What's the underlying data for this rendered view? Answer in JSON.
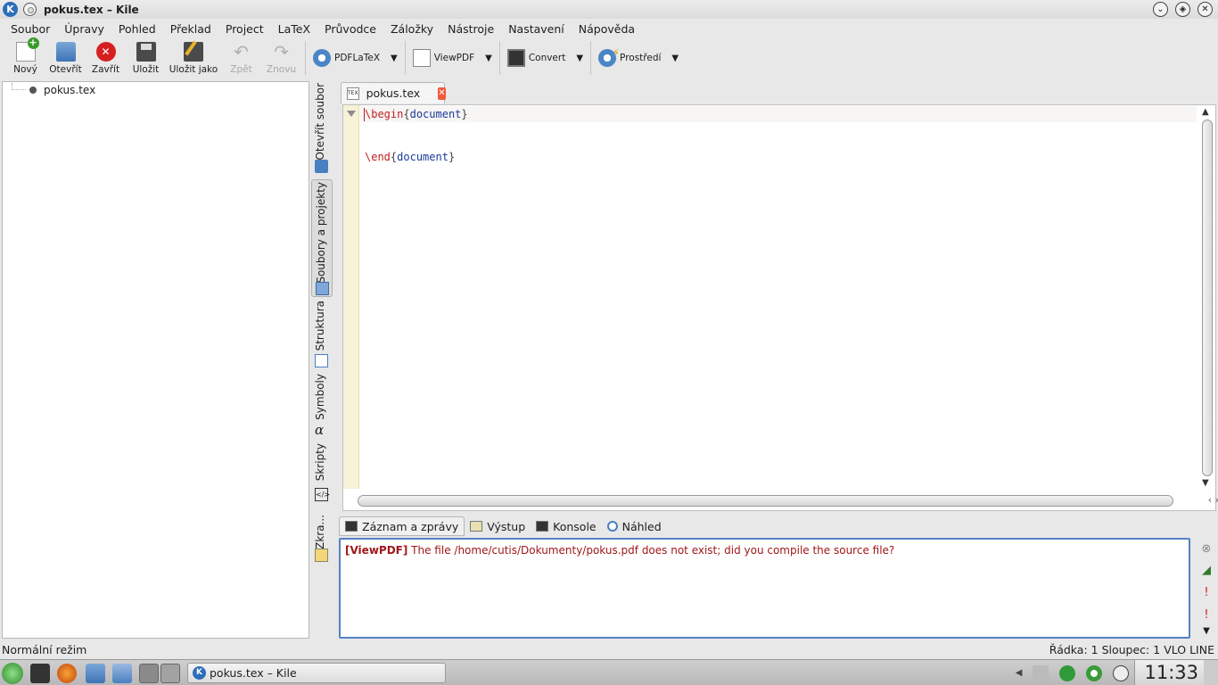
{
  "window": {
    "title": "pokus.tex – Kile"
  },
  "menubar": {
    "items": [
      "Soubor",
      "Úpravy",
      "Pohled",
      "Překlad",
      "Project",
      "LaTeX",
      "Průvodce",
      "Záložky",
      "Nástroje",
      "Nastavení",
      "Nápověda"
    ]
  },
  "toolbar": {
    "new_label": "Nový",
    "open_label": "Otevřít",
    "close_label": "Zavřít",
    "save_label": "Uložit",
    "saveas_label": "Uložit jako",
    "undo_label": "Zpět",
    "redo_label": "Znovu",
    "build_label": "PDFLaTeX",
    "view_label": "ViewPDF",
    "convert_label": "Convert",
    "env_label": "Prostředí"
  },
  "filetree": {
    "items": [
      {
        "label": "pokus.tex"
      }
    ]
  },
  "sidetabs": {
    "open_file": "Otevřít soubor",
    "files_projects": "Soubory a projekty",
    "structure": "Struktura",
    "symbols": "Symboly",
    "scripts": "Skripty",
    "abbrev": "Zkra..."
  },
  "editor": {
    "tab_label": "pokus.tex",
    "lines": [
      {
        "cmd": "\\begin",
        "open": "{",
        "arg": "document",
        "close": "}"
      },
      {
        "cmd": "\\end",
        "open": "{",
        "arg": "document",
        "close": "}"
      }
    ]
  },
  "logpanel": {
    "tabs": [
      "Záznam a zprávy",
      "Výstup",
      "Konsole",
      "Náhled"
    ],
    "message_tag": "[ViewPDF]",
    "message_text": "The file /home/cutis/Dokumenty/pokus.pdf does not exist; did you compile the source file?"
  },
  "statusbar": {
    "mode": "Normální režim",
    "position": "Řádka: 1 Sloupec: 1",
    "insert_mode": "VLO",
    "selection_mode": "LINE"
  },
  "taskbar": {
    "task_label": "pokus.tex – Kile",
    "clock": "11:33"
  },
  "colors": {
    "keyword": "#c02020",
    "argument": "#1a3a9a",
    "log_border": "#5582c4",
    "log_text": "#a01818"
  }
}
